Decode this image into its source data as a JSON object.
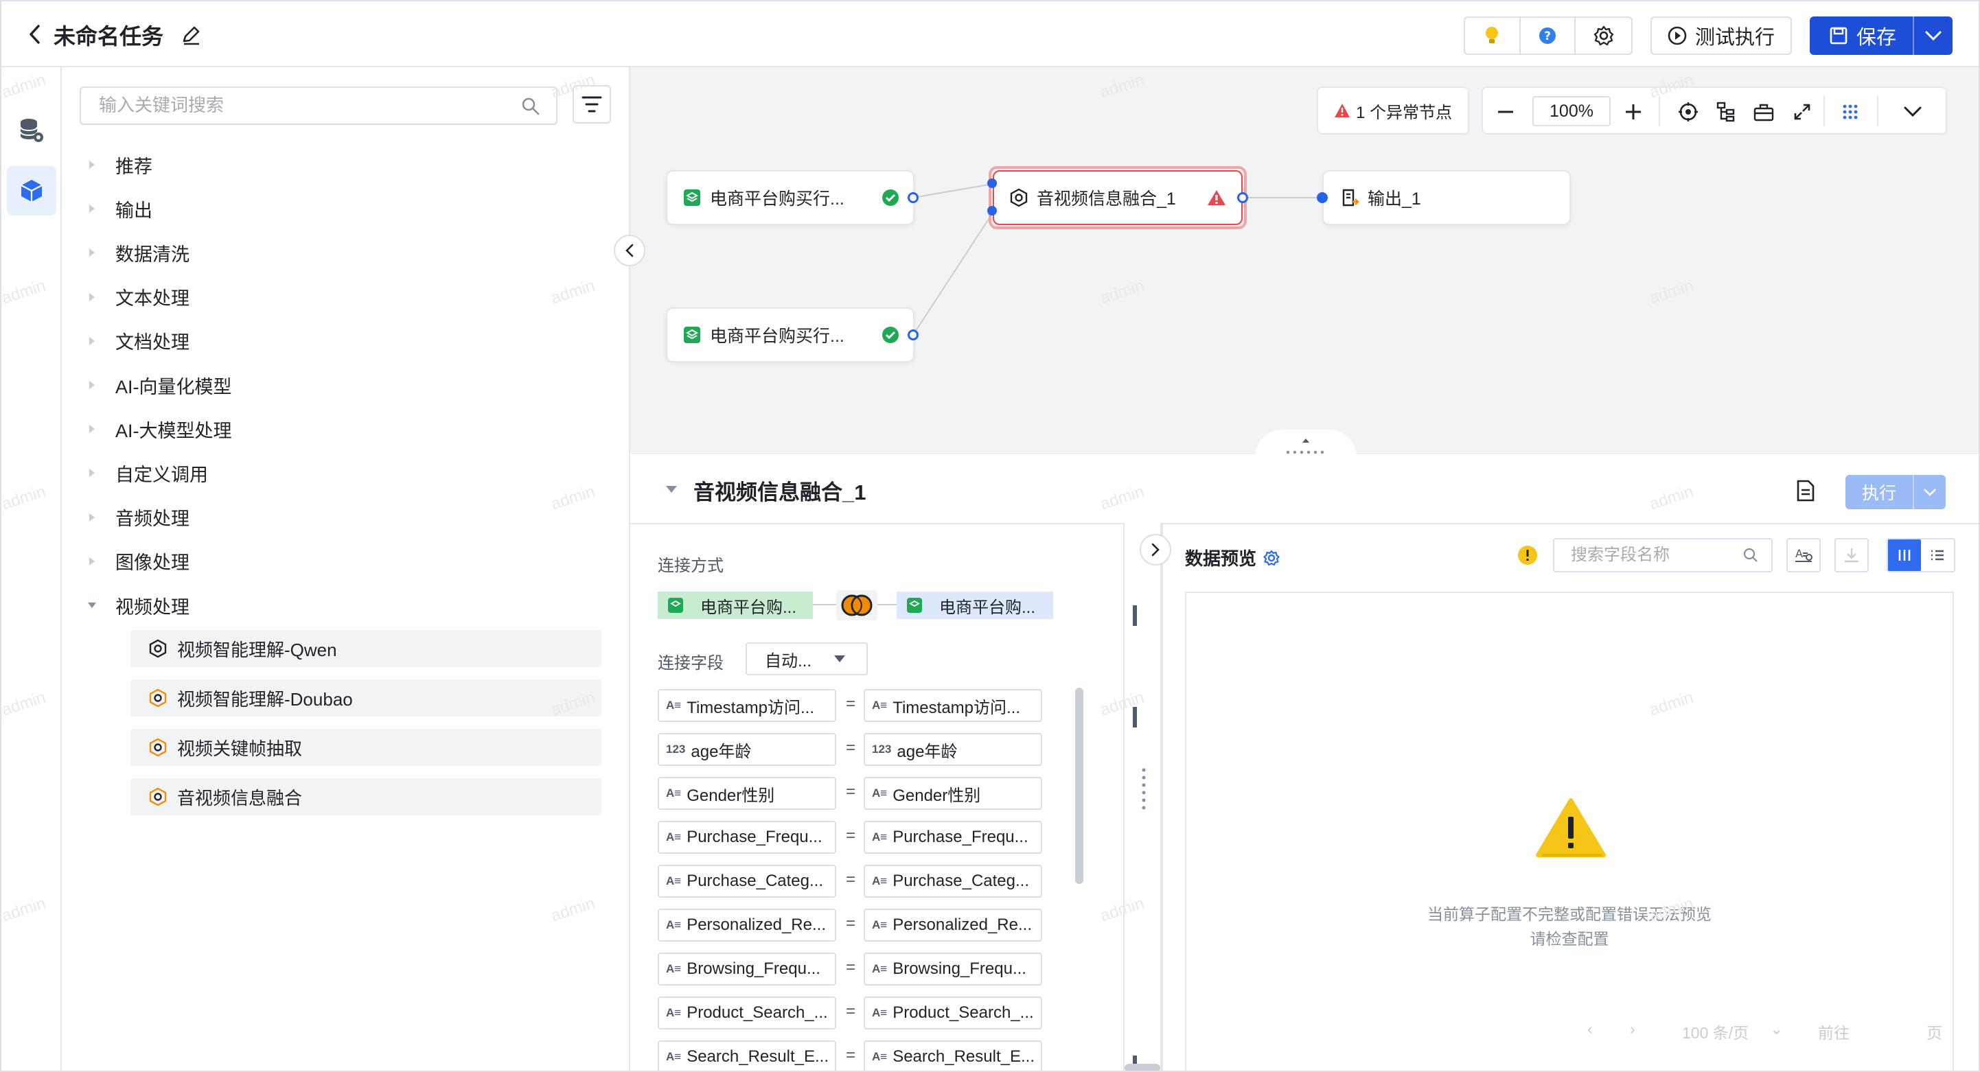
{
  "header": {
    "title": "未命名任务",
    "test_label": "测试执行",
    "save_label": "保存"
  },
  "panel": {
    "search_placeholder": "输入关键词搜索",
    "categories": [
      "推荐",
      "输出",
      "数据清洗",
      "文本处理",
      "文档处理",
      "AI-向量化模型",
      "AI-大模型处理",
      "自定义调用",
      "音频处理",
      "图像处理",
      "视频处理"
    ],
    "video_items": [
      "视频智能理解-Qwen",
      "视频智能理解-Doubao",
      "视频关键帧抽取",
      "音视频信息融合"
    ]
  },
  "canvas": {
    "warning": "1 个异常节点",
    "zoom": "100%",
    "nodes": {
      "source1": "电商平台购买行...",
      "source2": "电商平台购买行...",
      "fusion": "音视频信息融合_1",
      "output": "输出_1"
    }
  },
  "config": {
    "title": "音视频信息融合_1",
    "exec_label": "执行",
    "join_label": "连接方式",
    "left_table": "电商平台购...",
    "right_table": "电商平台购...",
    "join_field_label": "连接字段",
    "join_field_value": "自动...",
    "fields": [
      {
        "icon": "A≡",
        "left": "Timestamp访问...",
        "right": "Timestamp访问..."
      },
      {
        "icon": "123",
        "left": "age年龄",
        "right": "age年龄"
      },
      {
        "icon": "A≡",
        "left": "Gender性别",
        "right": "Gender性别"
      },
      {
        "icon": "A≡",
        "left": "Purchase_Frequ...",
        "right": "Purchase_Frequ..."
      },
      {
        "icon": "A≡",
        "left": "Purchase_Categ...",
        "right": "Purchase_Categ..."
      },
      {
        "icon": "A≡",
        "left": "Personalized_Re...",
        "right": "Personalized_Re..."
      },
      {
        "icon": "A≡",
        "left": "Browsing_Frequ...",
        "right": "Browsing_Frequ..."
      },
      {
        "icon": "A≡",
        "left": "Product_Search_...",
        "right": "Product_Search_..."
      },
      {
        "icon": "A≡",
        "left": "Search_Result_E...",
        "right": "Search_Result_E..."
      }
    ],
    "eq": "="
  },
  "preview": {
    "title": "数据预览",
    "search_placeholder": "搜索字段名称",
    "error_line1": "当前算子配置不完整或配置错误无法预览",
    "error_line2": "请检查配置",
    "page_size": "100 条/页",
    "goto": "前往",
    "page_unit": "页"
  },
  "watermark": "admin",
  "colors": {
    "primary": "#1d4ed8",
    "error": "#e5484d",
    "success": "#1fa855",
    "warning": "#f5c518",
    "canvas_bg": "#f2f3f5"
  }
}
